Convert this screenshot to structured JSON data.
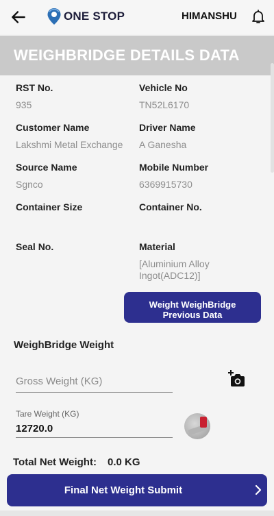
{
  "header": {
    "brand": "ONE STOP",
    "user": "HIMANSHU"
  },
  "banner": {
    "title": "WEIGHBRIDGE DETAILS DATA"
  },
  "details": {
    "rst_label": "RST No.",
    "rst_value": "935",
    "vehicle_label": "Vehicle No",
    "vehicle_value": "TN52L6170",
    "customer_label": "Customer Name",
    "customer_value": "Lakshmi Metal Exchange",
    "driver_label": "Driver Name",
    "driver_value": "A Ganesha",
    "source_label": "Source Name",
    "source_value": "Sgnco",
    "mobile_label": "Mobile Number",
    "mobile_value": "6369915730",
    "container_size_label": "Container Size",
    "container_no_label": "Container No.",
    "seal_label": "Seal No.",
    "material_label": "Material",
    "material_line1": "[Aluminium Alloy",
    "material_line2": "Ingot(ADC12)]"
  },
  "prev_button": {
    "line1": "Weight WeighBridge",
    "line2": "Previous Data"
  },
  "weight": {
    "section_title": "WeighBridge Weight",
    "gross_placeholder": "Gross Weight (KG)",
    "tare_label": "Tare Weight (KG)",
    "tare_value": "12720.0",
    "net_label": "Total Net Weight:",
    "net_value": "0.0 KG"
  },
  "submit": {
    "label": "Final Net Weight Submit"
  },
  "colors": {
    "primary": "#2d2f8f",
    "banner": "#c9c9c9",
    "logo": "#2c6fb5"
  },
  "icons": {
    "back": "arrow-left-icon",
    "logo": "location-pin-icon",
    "notifications": "bell-icon",
    "camera": "add-photo-icon",
    "submit_arrow": "chevron-right-icon"
  }
}
